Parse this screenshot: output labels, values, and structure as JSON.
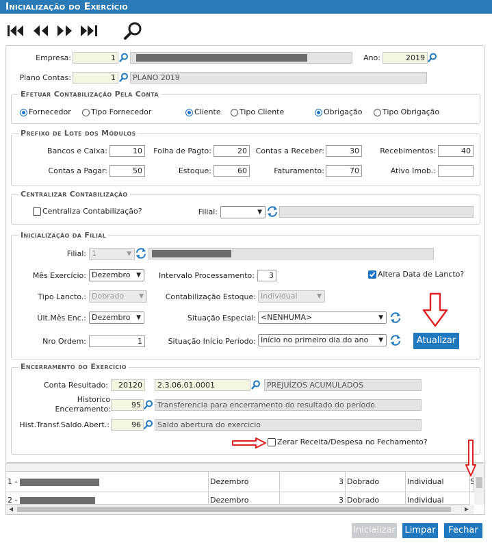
{
  "window": {
    "title": "Inicialização do Exercício"
  },
  "header": {
    "empresa_label": "Empresa:",
    "empresa_code": "1",
    "ano_label": "Ano:",
    "ano_value": "2019",
    "plano_label": "Plano Contas:",
    "plano_code": "1",
    "plano_name": "PLANO 2019"
  },
  "contabilizacao": {
    "legend": "Efetuar Contabilização Pela Conta",
    "fornecedor": "Fornecedor",
    "tipo_fornecedor": "Tipo Fornecedor",
    "cliente": "Cliente",
    "tipo_cliente": "Tipo Cliente",
    "obrigacao": "Obrigação",
    "tipo_obrigacao": "Tipo Obrigação"
  },
  "prefixo": {
    "legend": "Prefixo de Lote dos Módulos",
    "bancos_label": "Bancos e Caixa:",
    "bancos": "10",
    "folha_label": "Folha de Pagto:",
    "folha": "20",
    "receber_label": "Contas a Receber:",
    "receber": "30",
    "receb_label": "Recebimentos:",
    "receb": "40",
    "pagar_label": "Contas a Pagar:",
    "pagar": "50",
    "estoque_label": "Estoque:",
    "estoque": "60",
    "fat_label": "Faturamento:",
    "fat": "70",
    "ativo_label": "Ativo Imob.:",
    "ativo": ""
  },
  "centralizar": {
    "legend": "Centralizar Contabilização",
    "check_label": "Centraliza Contabilização?",
    "filial_label": "Filial:",
    "filial_value": ""
  },
  "filial_init": {
    "legend": "Inicialização da Filial",
    "filial_label": "Filial:",
    "filial_value": "1",
    "mes_label": "Mês Exercício:",
    "mes_value": "Dezembro",
    "intervalo_label": "Intervalo Processamento:",
    "intervalo_value": "3",
    "altera_label": "Altera Data de Lancto?",
    "tipo_label": "Tipo Lancto.:",
    "tipo_value": "Dobrado",
    "cont_estoque_label": "Contabilização Estoque:",
    "cont_estoque_value": "Individual",
    "ult_mes_label": "Últ.Mês Enc.:",
    "ult_mes_value": "Dezembro",
    "sit_especial_label": "Situação Especial:",
    "sit_especial_value": "<NENHUMA>",
    "nro_label": "Nro Ordem:",
    "nro_value": "1",
    "sit_inicio_label": "Situação Início Período:",
    "sit_inicio_value": "Início no primeiro dia do ano",
    "atualizar": "Atualizar"
  },
  "encerramento": {
    "legend": "Encerramento do Exercício",
    "conta_label": "Conta Resultado:",
    "conta_code": "20120",
    "conta_num": "2.3.06.01.0001",
    "conta_name": "PREJUÍZOS ACUMULADOS",
    "hist_label_1": "Historico",
    "hist_label_2": "Encerramento:",
    "hist_code": "95",
    "hist_desc": "Transferencia para encerramento do resultado do período",
    "transf_label": "Hist.Transf.Saldo.Abert.:",
    "transf_code": "96",
    "transf_desc": "Saldo abertura do exercicio",
    "zerar_label": "Zerar Receita/Despesa no Fechamento?"
  },
  "grid": {
    "rows": [
      {
        "filial": "1 -",
        "mes": "Dezembro",
        "intervalo": "3",
        "tipo": "Dobrado",
        "estoque": "Individual",
        "extra": "S"
      },
      {
        "filial": "2 -",
        "mes": "Dezembro",
        "intervalo": "3",
        "tipo": "Dobrado",
        "estoque": "Individual",
        "extra": ""
      }
    ]
  },
  "footer": {
    "inicializar": "Inicializar",
    "limpar": "Limpar",
    "fechar": "Fechar"
  },
  "colors": {
    "accent": "#2079bf",
    "title_bar": "#2a7ab8",
    "arrow_red": "#e02020"
  }
}
